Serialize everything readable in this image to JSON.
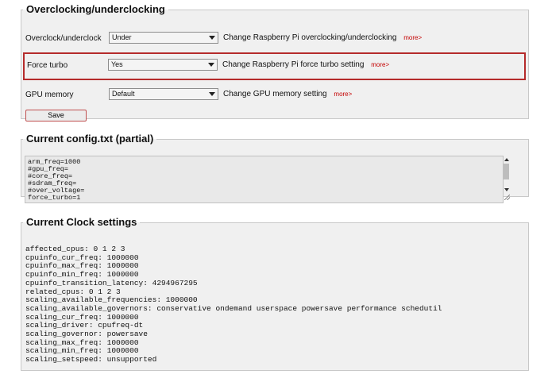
{
  "overclock": {
    "legend": "Overclocking/underclocking",
    "rows": [
      {
        "label": "Overclock/underclock",
        "value": "Under",
        "description": "Change Raspberry Pi overclocking/underclocking",
        "more": "more>"
      },
      {
        "label": "Force turbo",
        "value": "Yes",
        "description": "Change Raspberry Pi force turbo setting",
        "more": "more>"
      },
      {
        "label": "GPU memory",
        "value": "Default",
        "description": "Change GPU memory setting",
        "more": "more>"
      }
    ],
    "save_label": "Save"
  },
  "config": {
    "legend": "Current config.txt (partial)",
    "text": "arm_freq=1000\n#gpu_freq=\n#core_freq=\n#sdram_freq=\n#over_voltage=\nforce_turbo=1"
  },
  "clock": {
    "legend": "Current Clock settings",
    "text": "affected_cpus: 0 1 2 3\ncpuinfo_cur_freq: 1000000\ncpuinfo_max_freq: 1000000\ncpuinfo_min_freq: 1000000\ncpuinfo_transition_latency: 4294967295\nrelated_cpus: 0 1 2 3\nscaling_available_frequencies: 1000000\nscaling_available_governors: conservative ondemand userspace powersave performance schedutil\nscaling_cur_freq: 1000000\nscaling_driver: cpufreq-dt\nscaling_governor: powersave\nscaling_max_freq: 1000000\nscaling_min_freq: 1000000\nscaling_setspeed: unsupported"
  },
  "icons": {
    "dropdown": "chevron-down-icon",
    "scroll_up": "scroll-up-icon",
    "scroll_down": "scroll-down-icon",
    "resize": "resize-grip-icon"
  },
  "colors": {
    "highlight_border": "#b52b2b",
    "more_link": "#c40000",
    "panel_bg": "#f0f0f0"
  }
}
